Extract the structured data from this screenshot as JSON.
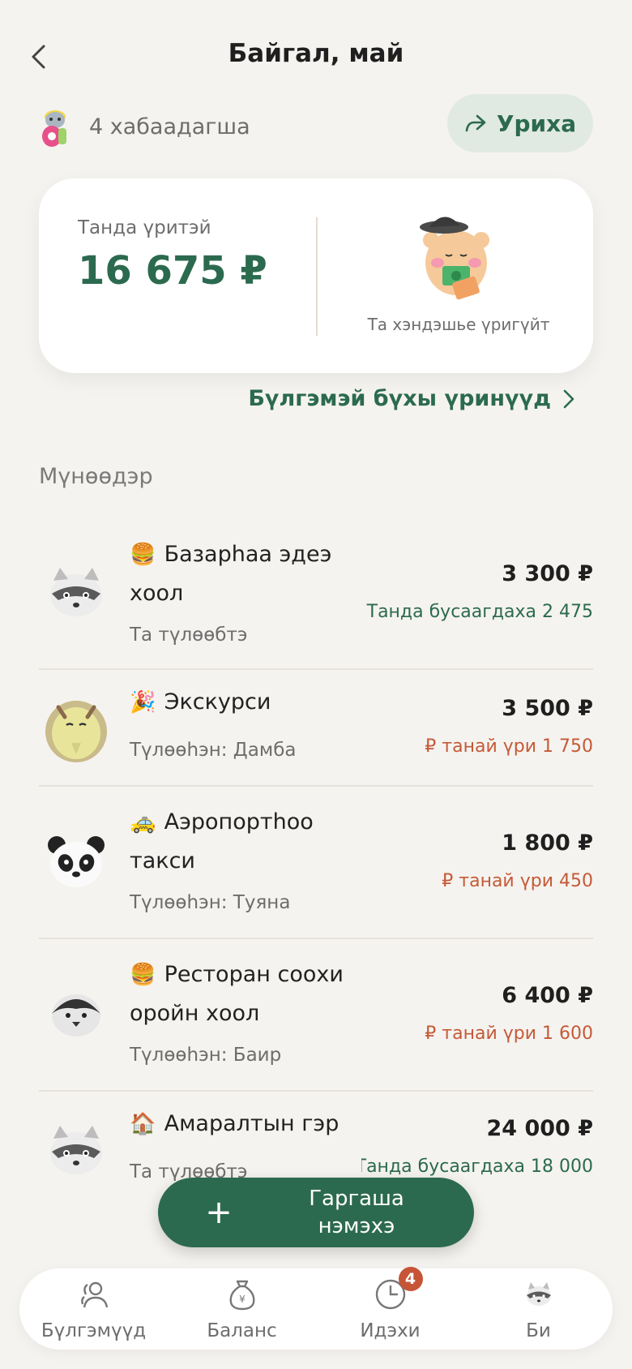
{
  "header": {
    "title": "Байгал, май",
    "back_icon": "chevron-left-icon"
  },
  "members": {
    "count_label": "4 хабаадагша",
    "share_label": "Уриха",
    "share_icon": "share-arrow-icon"
  },
  "balance": {
    "label": "Танда үритэй",
    "amount": "16 675 ₽",
    "mascot_caption": "Та хэндэшье үригүйт"
  },
  "all_debts_label": "Бүлгэмэй бүхы үринүүд",
  "section_today": "Мүнөөдэр",
  "expenses": [
    {
      "icon": "🍔",
      "title": "Базарhaa эдеэ хоол",
      "subtitle": "Та түлөөбтэ",
      "amount": "3 300 ₽",
      "note": "Танда бусаагдаха 2 475 ₽",
      "note_type": "green",
      "avatar": "raccoon"
    },
    {
      "icon": "🎉",
      "title": "Экскурси",
      "subtitle": "Түлөөһэн: Дамба",
      "amount": "3 500 ₽",
      "note": "танай үри 1 750 ₽",
      "note_type": "red",
      "avatar": "goat"
    },
    {
      "icon": "🚕",
      "title": "Аэропортhoo такси",
      "subtitle": "Түлөөһэн: Туяна",
      "amount": "1 800 ₽",
      "note": "танай үри 450 ₽",
      "note_type": "red",
      "avatar": "panda"
    },
    {
      "icon": "🍔",
      "title": "Ресторан соохи оройн хоол",
      "subtitle": "Түлөөһэн: Баир",
      "amount": "6 400 ₽",
      "note": "танай үри 1 600 ₽",
      "note_type": "red",
      "avatar": "penguin"
    },
    {
      "icon": "🏠",
      "title": "Амаралтын гэр",
      "subtitle": "Та түлөөбтэ",
      "amount": "24 000 ₽",
      "note": "Танда бусаагдаха 18 000 ₽",
      "note_type": "green",
      "avatar": "raccoon"
    }
  ],
  "add_button": {
    "label": "Гаргаша нэмэхэ"
  },
  "tabbar": {
    "tabs": [
      {
        "label": "Бүлгэмүүд",
        "icon": "people-icon"
      },
      {
        "label": "Баланс",
        "icon": "money-bag-icon"
      },
      {
        "label": "Идэхи",
        "icon": "clock-icon",
        "badge": "4"
      },
      {
        "label": "Би",
        "icon": "raccoon-avatar-icon"
      }
    ]
  },
  "colors": {
    "accent": "#2c6a4f",
    "danger": "#c45a38",
    "background": "#f5f3ef"
  }
}
